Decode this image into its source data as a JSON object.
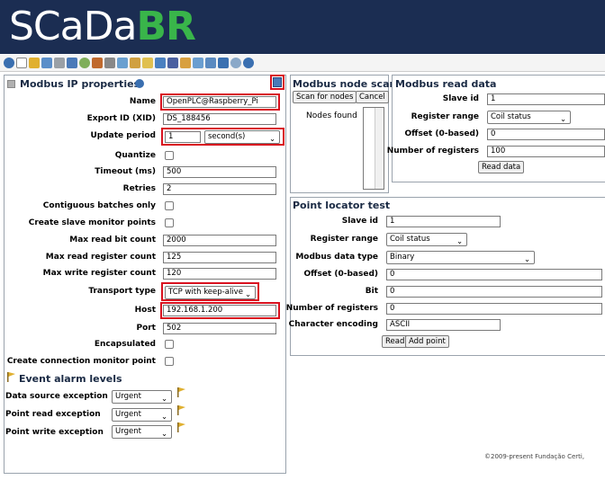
{
  "app": {
    "logo_part1": "SCaDa",
    "logo_part2": "BR"
  },
  "toolbar": {
    "icons": [
      "watchlist-icon",
      "graphical-views-icon",
      "events-icon",
      "data-sources-icon",
      "scheduled-events-icon",
      "event-handlers-icon",
      "compound-events-icon",
      "point-links-icon",
      "scripting-icon",
      "users-icon",
      "point-hierarchy-icon",
      "mailing-lists-icon",
      "publishers-icon",
      "maintenance-events-icon",
      "system-settings-icon",
      "emport-icon",
      "sql-icon",
      "reports-icon",
      "logout-icon",
      "help-icon"
    ]
  },
  "modbus_ip": {
    "title": "Modbus IP properties",
    "name_label": "Name",
    "name_value": "OpenPLC@Raspberry_Pi",
    "xid_label": "Export ID (XID)",
    "xid_value": "DS_188456",
    "update_label": "Update period",
    "update_value": "1",
    "update_unit": "second(s)",
    "quantize_label": "Quantize",
    "timeout_label": "Timeout (ms)",
    "timeout_value": "500",
    "retries_label": "Retries",
    "retries_value": "2",
    "contiguous_label": "Contiguous batches only",
    "slave_monitor_label": "Create slave monitor points",
    "max_read_bit_label": "Max read bit count",
    "max_read_bit_value": "2000",
    "max_read_reg_label": "Max read register count",
    "max_read_reg_value": "125",
    "max_write_reg_label": "Max write register count",
    "max_write_reg_value": "120",
    "transport_label": "Transport type",
    "transport_value": "TCP with keep-alive",
    "host_label": "Host",
    "host_value": "192.168.1.200",
    "port_label": "Port",
    "port_value": "502",
    "encapsulated_label": "Encapsulated",
    "conn_monitor_label": "Create connection monitor point"
  },
  "alarm_levels": {
    "title": "Event alarm levels",
    "ds_exception_label": "Data source exception",
    "ds_exception_value": "Urgent",
    "pr_exception_label": "Point read exception",
    "pr_exception_value": "Urgent",
    "pw_exception_label": "Point write exception",
    "pw_exception_value": "Urgent"
  },
  "node_scan": {
    "title": "Modbus node scan",
    "scan_button": "Scan for nodes",
    "cancel_button": "Cancel",
    "nodes_found_label": "Nodes found"
  },
  "read_data": {
    "title": "Modbus read data",
    "slave_label": "Slave id",
    "slave_value": "1",
    "range_label": "Register range",
    "range_value": "Coil status",
    "offset_label": "Offset (0-based)",
    "offset_value": "0",
    "num_label": "Number of registers",
    "num_value": "100",
    "read_button": "Read data"
  },
  "locator_test": {
    "title": "Point locator test",
    "slave_label": "Slave id",
    "slave_value": "1",
    "range_label": "Register range",
    "range_value": "Coil status",
    "type_label": "Modbus data type",
    "type_value": "Binary",
    "offset_label": "Offset (0-based)",
    "offset_value": "0",
    "bit_label": "Bit",
    "bit_value": "0",
    "num_label": "Number of registers",
    "num_value": "0",
    "encoding_label": "Character encoding",
    "encoding_value": "ASCII",
    "read_button": "Read",
    "add_button": "Add point"
  },
  "footer": {
    "copyright": "©2009-present Fundação Certi,"
  },
  "colors": {
    "header_bg": "#1b2d52",
    "logo_accent": "#39b54a",
    "highlight": "#d9121f"
  }
}
